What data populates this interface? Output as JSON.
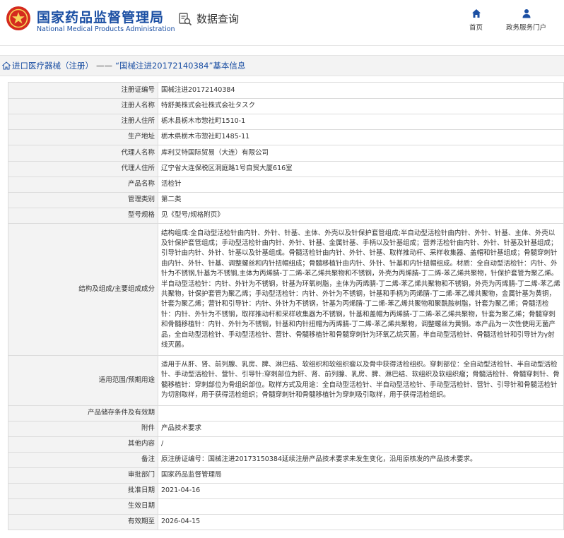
{
  "header": {
    "org_cn": "国家药品监督管理局",
    "org_en": "National Medical Products Administration",
    "search_label": "数据查询",
    "nav_home": "首页",
    "nav_portal": "政务服务门户",
    "brand_color": "#1b4fa3",
    "logo_color": "#d52b1e"
  },
  "breadcrumb": {
    "section": "进口医疗器械（注册）",
    "separator": "——",
    "current": "“国械注进20172140384”基本信息"
  },
  "details": [
    {
      "key": "注册证编号",
      "value": "国械注进20172140384"
    },
    {
      "key": "注册人名称",
      "value": "特舒美株式会社株式会社タスク"
    },
    {
      "key": "注册人住所",
      "value": "栃木县栃木市惣社町1510-1"
    },
    {
      "key": "生产地址",
      "value": "栃木県栃木市惣社町1485-11"
    },
    {
      "key": "代理人名称",
      "value": "库利艾特国际贸易（大连）有限公司"
    },
    {
      "key": "代理人住所",
      "value": "辽宁省大连保税区洞庭路1号自贸大厦616室"
    },
    {
      "key": "产品名称",
      "value": "活检针"
    },
    {
      "key": "管理类别",
      "value": "第二类"
    },
    {
      "key": "型号规格",
      "value": "见《型号/规格附页》"
    },
    {
      "key": "结构及组成/主要组成成分",
      "value": "结构组成:全自动型活检针由内针、外针、针基、主体、外壳以及针保护套管组成;半自动型活检针由内针、外针、针基、主体、外壳以及针保护套管组成；手动型活检针由内针、外针、针基、金属针基、手柄以及针基组成；营养活检针由内针、外针、针基及针基组成；引导针由内针、外针、针基以及针基组成。骨髓活检针由内针、外针、针基、取样推动杆、采样收集器、盖帽和针基组成；骨髓穿刺针由内针、外针、针基、调整螺丝和内针扭帽组成；骨髓移植针由内针、外针、针基和内针扭帽组成。材质：全自动型活检针：内针、外针为不锈钢,针基为不锈钢,主体为丙烯腈-丁二烯-苯乙烯共聚物和不锈钢，外壳为丙烯腈-丁二烯-苯乙烯共聚物，针保护套管为聚乙烯。半自动型活检针：内针、外针为不锈钢，针基为环氧树脂，主体为丙烯腈-丁二烯-苯乙烯共聚物和不锈钢，外壳为丙烯腈-丁二烯-苯乙烯共聚物，针保护套管为聚乙烯；手动型活检针：内针、外针为不锈钢，针基和手柄为丙烯腈-丁二烯-苯乙烯共聚物，金属针基为黄铜，针套为聚乙烯；营针和引导针：内针、外针为不锈钢，针基为丙烯腈-丁二烯-苯乙烯共聚物和聚酰胺树脂，针套为聚乙烯；骨髓活检针：内针、外针为不锈钢，取样推动杆和采样收集器为不锈钢，针基和盖帽为丙烯腈-丁二烯-苯乙烯共聚物，针套为聚乙烯；骨髓穿刺和骨髓移植针：内针、外针为不锈钢，针基和内针扭帽为丙烯腈-丁二烯-苯乙烯共聚物，调整螺丝为黄铜。本产品为一次性使用无菌产品，全自动型活检针、手动型活检针、营针、骨髓移植针和骨髓穿刺针为环氧乙烷灭菌，半自动型活检针、骨髓活检针和引导针为γ射线灭菌。"
    },
    {
      "key": "适用范围/预期用途",
      "value": "适用于从肝、肾、前列腺、乳房、脾、淋巴结、软组织和软组织瘤以及骨中获得活检组织。穿刺部位：全自动型活检针、半自动型活检针、手动型活检针、营针、引导针:穿刺部位为肝、肾、前列腺、乳房、脾、淋巴结、软组织及软组织瘤；骨髓活检针、骨髓穿刺针、骨髓移植针：穿刺部位为骨组织部位。取样方式及用途：全自动型活检针、半自动型活检针、手动型活检针、营针、引导针和骨髓活检针为切割取样，用于获得活检组织；骨髓穿刺针和骨髓移植针为穿刺吸引取样，用于获得活检组织。"
    },
    {
      "key": "产品储存条件及有效期",
      "value": ""
    },
    {
      "key": "附件",
      "value": "产品技术要求"
    },
    {
      "key": "其他内容",
      "value": "/"
    },
    {
      "key": "备注",
      "value": "原注册证编号：国械注进20173150384延续注册产品技术要求未发生变化，沿用原核发的产品技术要求。"
    },
    {
      "key": "审批部门",
      "value": "国家药品监督管理局"
    },
    {
      "key": "批准日期",
      "value": "2021-04-16"
    },
    {
      "key": "生效日期",
      "value": ""
    },
    {
      "key": "有效期至",
      "value": "2026-04-15"
    }
  ]
}
